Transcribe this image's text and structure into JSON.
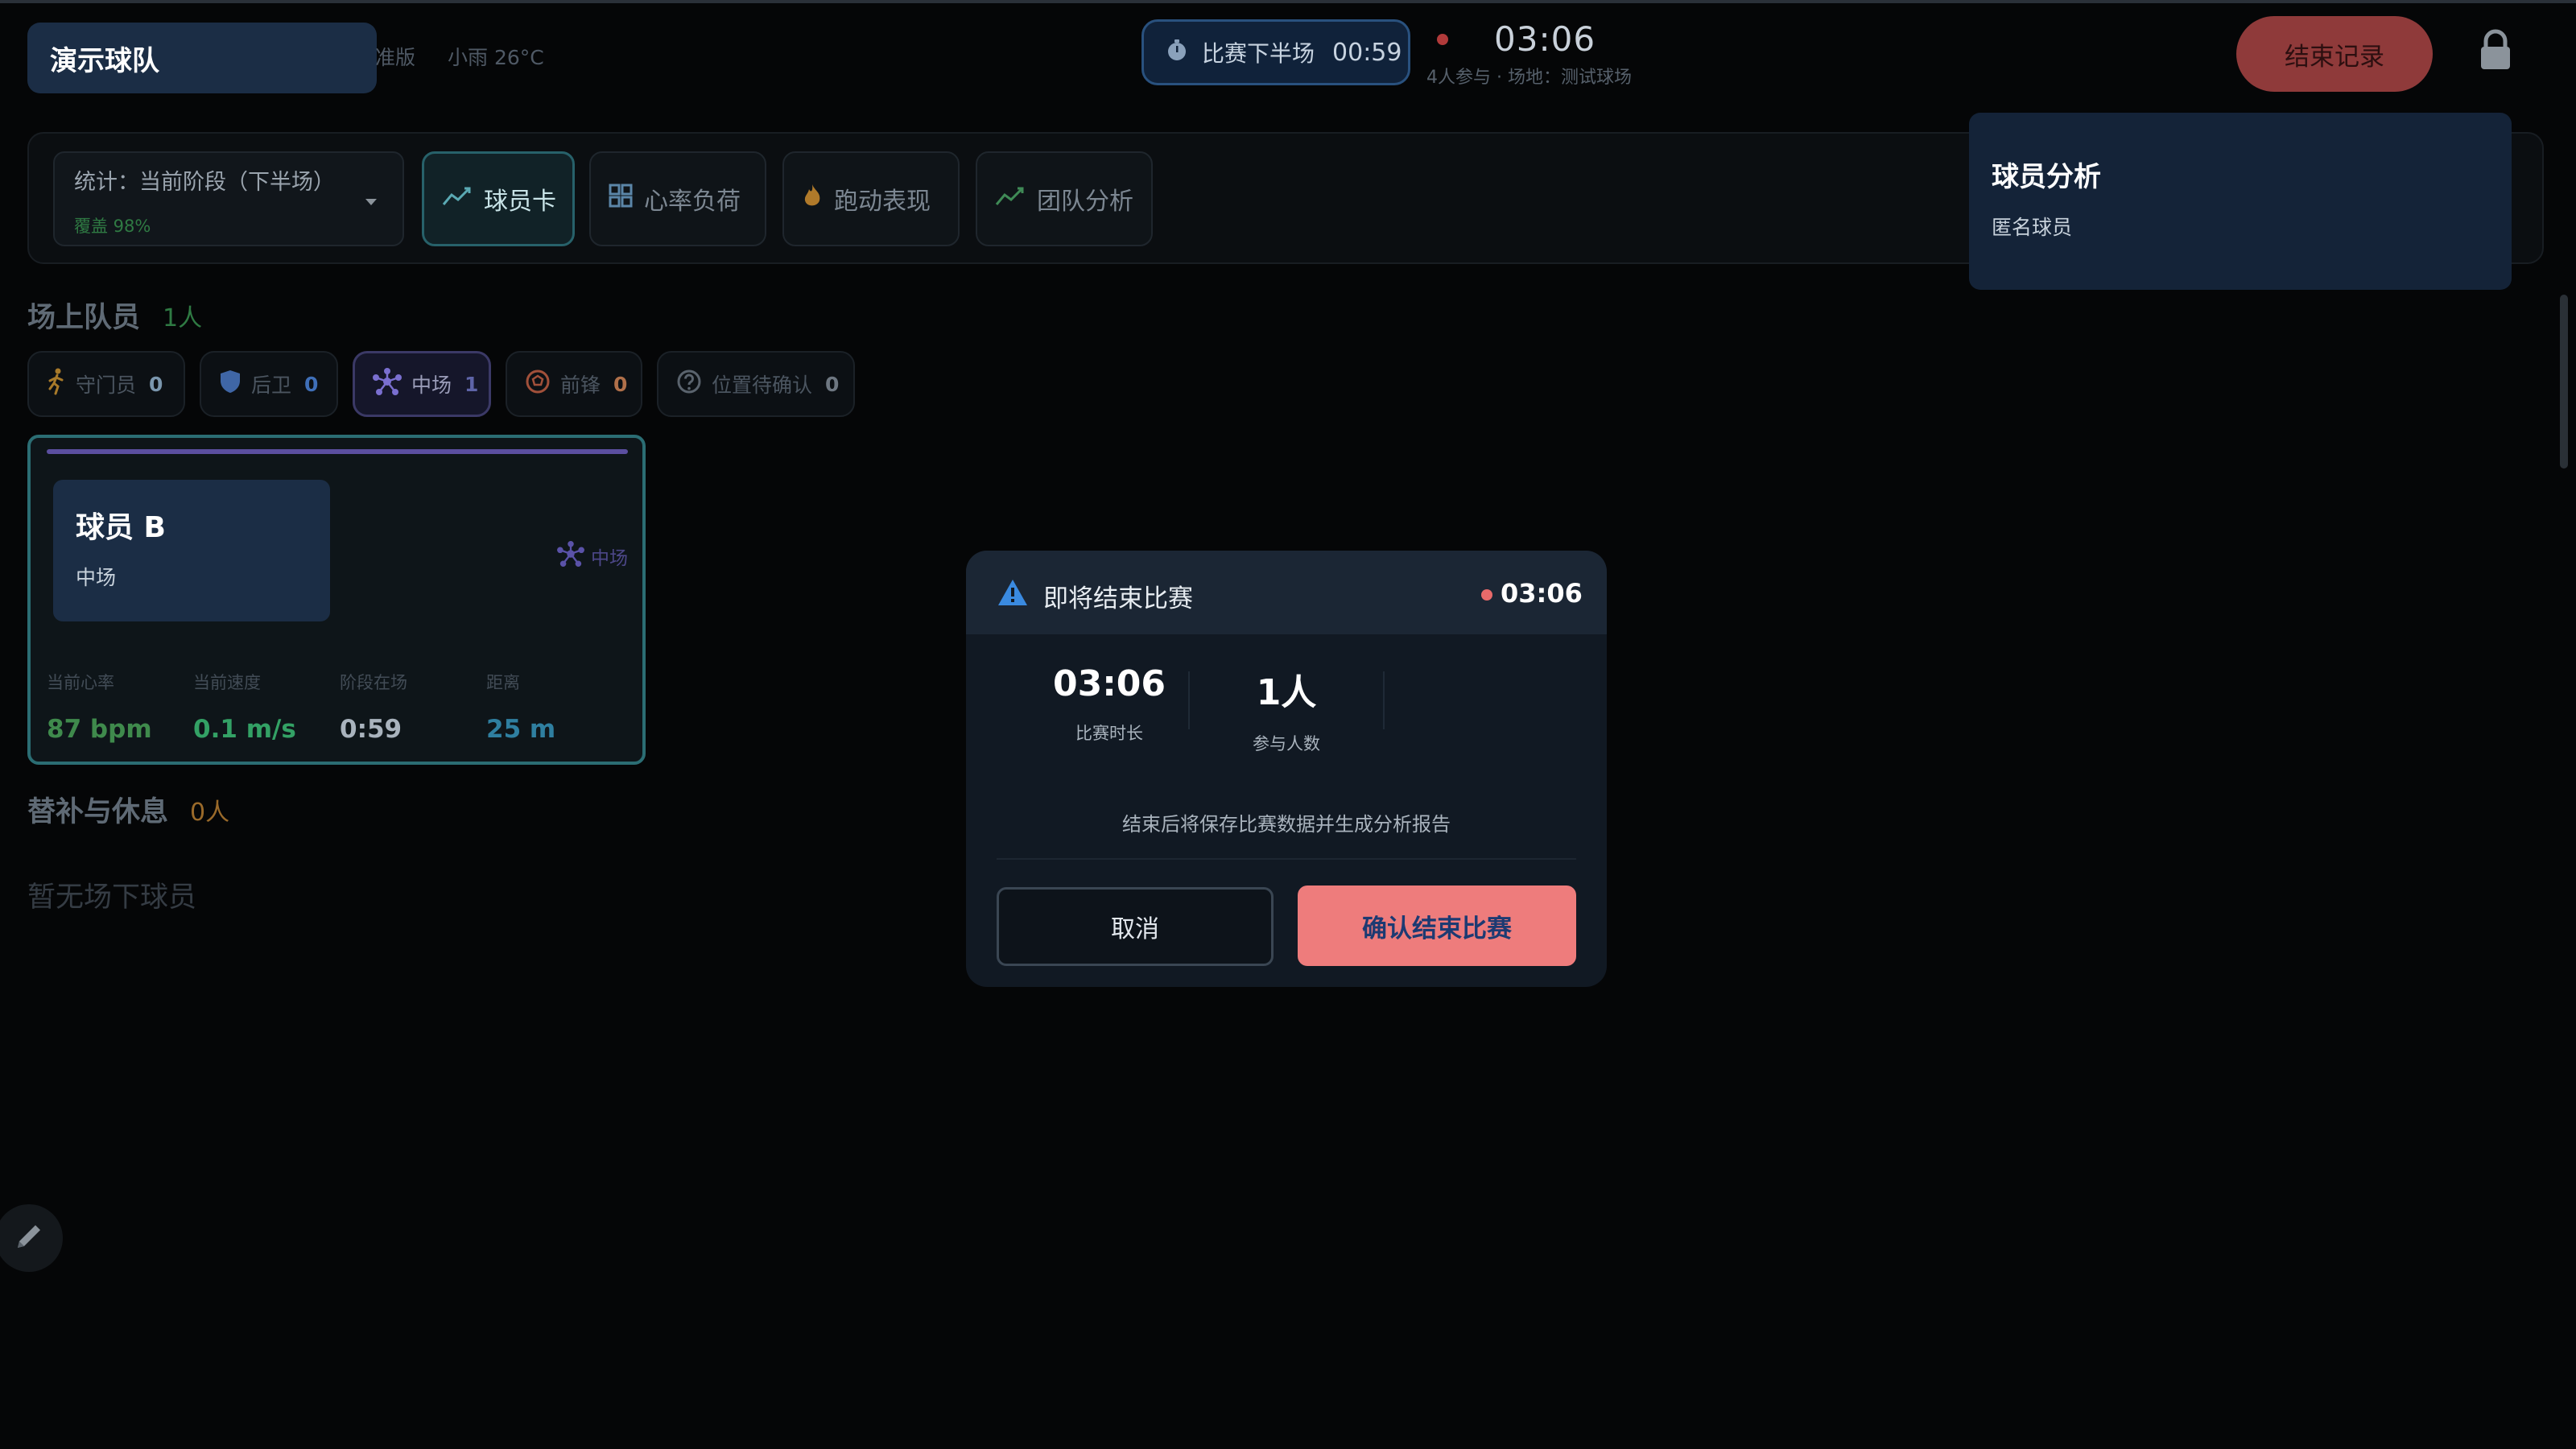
{
  "header": {
    "team_name": "演示球队",
    "edition": "准版",
    "weather": "小雨 26°C",
    "half_label": "比赛下半场",
    "half_time": "00:59",
    "match_clock": "03:06",
    "venue_info": "4人参与 · 场地：测试球场",
    "end_record_label": "结束记录"
  },
  "toolbar": {
    "stat_label": "统计：当前阶段（下半场）",
    "coverage": "覆盖 98%",
    "tabs": [
      {
        "label": "球员卡",
        "icon": "trend-icon",
        "active": true
      },
      {
        "label": "心率负荷",
        "icon": "grid-icon",
        "active": false
      },
      {
        "label": "跑动表现",
        "icon": "flame-icon",
        "active": false
      },
      {
        "label": "团队分析",
        "icon": "trend-icon",
        "active": false
      }
    ]
  },
  "side_panel": {
    "title": "球员分析",
    "subtitle": "匿名球员"
  },
  "on_field": {
    "title": "场上队员",
    "count": "1人",
    "positions": [
      {
        "label": "守门员",
        "count": "0",
        "icon": "runner-icon"
      },
      {
        "label": "后卫",
        "count": "0",
        "icon": "shield-icon"
      },
      {
        "label": "中场",
        "count": "1",
        "icon": "network-icon"
      },
      {
        "label": "前锋",
        "count": "0",
        "icon": "ball-icon"
      },
      {
        "label": "位置待确认",
        "count": "0",
        "icon": "question-icon"
      }
    ]
  },
  "player_card": {
    "name": "球员 B",
    "position": "中场",
    "tag": "中场",
    "metrics": [
      {
        "label": "当前心率",
        "value": "87 bpm",
        "color": "#3f8a4c"
      },
      {
        "label": "当前速度",
        "value": "0.1 m/s",
        "color": "#33a165"
      },
      {
        "label": "阶段在场",
        "value": "0:59",
        "color": "#a9b3bd"
      },
      {
        "label": "距离",
        "value": "25 m",
        "color": "#2f7fa0"
      }
    ]
  },
  "bench": {
    "title": "替补与休息",
    "count": "0人",
    "empty_text": "暂无场下球员"
  },
  "modal": {
    "title": "即将结束比赛",
    "time": "03:06",
    "duration_value": "03:06",
    "duration_label": "比赛时长",
    "participants_value": "1人",
    "participants_label": "参与人数",
    "note": "结束后将保存比赛数据并生成分析报告",
    "cancel_label": "取消",
    "confirm_label": "确认结束比赛"
  }
}
